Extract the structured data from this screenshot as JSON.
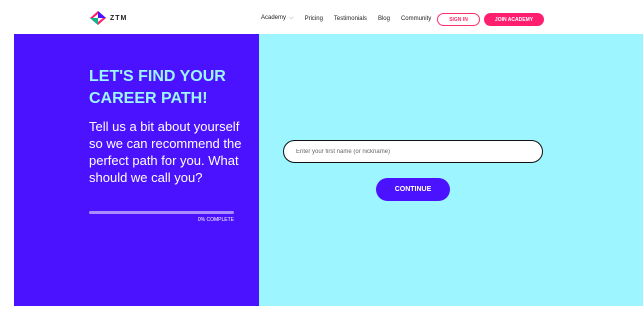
{
  "brand": {
    "name": "ZTM",
    "colors": {
      "primary": "#4b12ff",
      "accent": "#9df6ff",
      "pink": "#ff1f6e"
    }
  },
  "nav": {
    "links": [
      {
        "label": "Academy",
        "has_dropdown": true
      },
      {
        "label": "Pricing"
      },
      {
        "label": "Testimonials"
      },
      {
        "label": "Blog"
      },
      {
        "label": "Community"
      }
    ],
    "signin_label": "SIGN IN",
    "join_label": "JOIN ACADEMY"
  },
  "hero": {
    "headline": "LET'S FIND YOUR CAREER PATH!",
    "subtext": "Tell us a bit about yourself so we can recommend the perfect path for you. What should we call you?",
    "progress_label": "0% COMPLETE",
    "progress_fraction": 0.0
  },
  "form": {
    "name_placeholder": "Enter your first name (or nickname)",
    "name_value": "",
    "continue_label": "CONTINUE"
  }
}
